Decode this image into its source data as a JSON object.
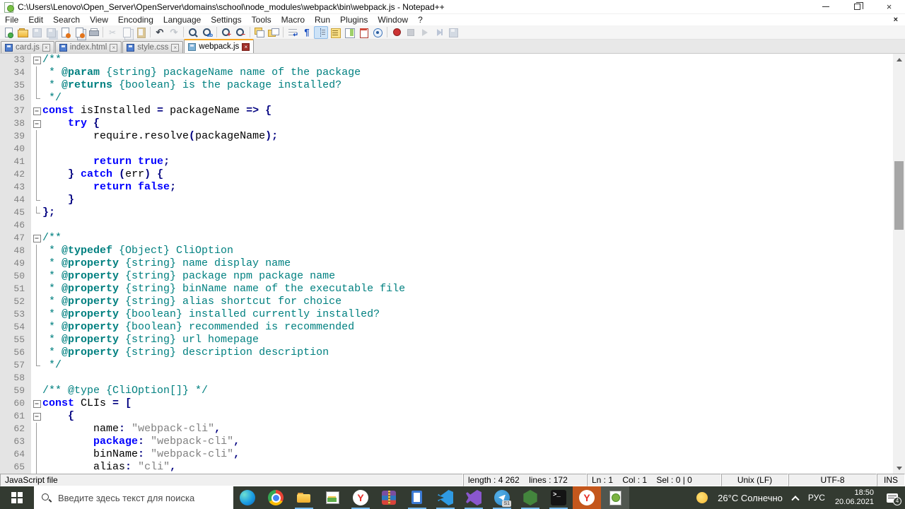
{
  "colors": {
    "comment": "#008080",
    "keyword": "#0000ff",
    "operator": "#000080",
    "string": "#808080",
    "line_number": "#808080",
    "margin_bg": "#e4e4e4",
    "tab_accent": "#f5a623",
    "taskbar_bg": "#333a31",
    "taskbar_active_bg": "#c4571c",
    "taskbar_running_underline": "#76b9ed"
  },
  "window": {
    "title": "C:\\Users\\Lenovo\\Open_Server\\OpenServer\\domains\\school\\node_modules\\webpack\\bin\\webpack.js - Notepad++"
  },
  "menu": {
    "items": [
      "File",
      "Edit",
      "Search",
      "View",
      "Encoding",
      "Language",
      "Settings",
      "Tools",
      "Macro",
      "Run",
      "Plugins",
      "Window",
      "?"
    ],
    "close_label": "×"
  },
  "toolbar": {
    "items": [
      {
        "name": "new-file"
      },
      {
        "name": "open-file"
      },
      {
        "name": "save-file",
        "disabled": true
      },
      {
        "name": "save-all",
        "disabled": true
      },
      {
        "name": "close-file"
      },
      {
        "name": "close-all"
      },
      {
        "name": "print"
      },
      {
        "sep": true
      },
      {
        "name": "cut",
        "disabled": true
      },
      {
        "name": "copy",
        "disabled": true
      },
      {
        "name": "paste",
        "disabled": true
      },
      {
        "sep": true
      },
      {
        "name": "undo"
      },
      {
        "name": "redo",
        "disabled": true
      },
      {
        "sep": true
      },
      {
        "name": "find"
      },
      {
        "name": "replace"
      },
      {
        "sep": true
      },
      {
        "name": "zoom-in"
      },
      {
        "name": "zoom-out"
      },
      {
        "sep": true
      },
      {
        "name": "sync-vertical"
      },
      {
        "name": "sync-horizontal"
      },
      {
        "sep": true
      },
      {
        "name": "word-wrap"
      },
      {
        "name": "show-all-characters"
      },
      {
        "name": "indent-guides",
        "selected": true
      },
      {
        "name": "function-list"
      },
      {
        "name": "document-map"
      },
      {
        "name": "document-list"
      },
      {
        "name": "monitoring"
      },
      {
        "sep": true
      },
      {
        "name": "record-macro"
      },
      {
        "name": "stop-macro",
        "disabled": true
      },
      {
        "name": "play-macro",
        "disabled": true
      },
      {
        "name": "run-macro-multiple",
        "disabled": true
      },
      {
        "name": "save-macro",
        "disabled": true
      }
    ]
  },
  "tabs": [
    {
      "label": "card.js"
    },
    {
      "label": "index.html"
    },
    {
      "label": "style.css"
    },
    {
      "label": "webpack.js",
      "active": true
    }
  ],
  "editor": {
    "lines": [
      {
        "n": 33,
        "f": "box",
        "segs": [
          [
            "c",
            "/**"
          ]
        ]
      },
      {
        "n": 34,
        "f": "v",
        "segs": [
          [
            "c",
            " * "
          ],
          [
            "cb",
            "@param"
          ],
          [
            "c",
            " {string} packageName name of the package"
          ]
        ]
      },
      {
        "n": 35,
        "f": "v",
        "segs": [
          [
            "c",
            " * "
          ],
          [
            "cb",
            "@returns"
          ],
          [
            "c",
            " {boolean} is the package installed?"
          ]
        ]
      },
      {
        "n": 36,
        "f": "end",
        "segs": [
          [
            "c",
            " */"
          ]
        ]
      },
      {
        "n": 37,
        "f": "box",
        "segs": [
          [
            "k",
            "const"
          ],
          [
            "d",
            " isInstalled "
          ],
          [
            "o",
            "="
          ],
          [
            "d",
            " packageName "
          ],
          [
            "o",
            "=>"
          ],
          [
            "d",
            " "
          ],
          [
            "o",
            "{"
          ]
        ]
      },
      {
        "n": 38,
        "f": "box",
        "segs": [
          [
            "d",
            "    "
          ],
          [
            "k",
            "try"
          ],
          [
            "d",
            " "
          ],
          [
            "o",
            "{"
          ]
        ]
      },
      {
        "n": 39,
        "f": "v",
        "segs": [
          [
            "d",
            "        require.resolve"
          ],
          [
            "o",
            "("
          ],
          [
            "d",
            "packageName"
          ],
          [
            "o",
            ");"
          ]
        ]
      },
      {
        "n": 40,
        "f": "v",
        "segs": []
      },
      {
        "n": 41,
        "f": "v",
        "segs": [
          [
            "d",
            "        "
          ],
          [
            "k",
            "return"
          ],
          [
            "d",
            " "
          ],
          [
            "k",
            "true"
          ],
          [
            "o",
            ";"
          ]
        ]
      },
      {
        "n": 42,
        "f": "v",
        "segs": [
          [
            "d",
            "    "
          ],
          [
            "o",
            "}"
          ],
          [
            "d",
            " "
          ],
          [
            "k",
            "catch"
          ],
          [
            "d",
            " "
          ],
          [
            "o",
            "("
          ],
          [
            "d",
            "err"
          ],
          [
            "o",
            ")"
          ],
          [
            "d",
            " "
          ],
          [
            "o",
            "{"
          ]
        ]
      },
      {
        "n": 43,
        "f": "v",
        "segs": [
          [
            "d",
            "        "
          ],
          [
            "k",
            "return"
          ],
          [
            "d",
            " "
          ],
          [
            "k",
            "false"
          ],
          [
            "o",
            ";"
          ]
        ]
      },
      {
        "n": 44,
        "f": "end",
        "segs": [
          [
            "d",
            "    "
          ],
          [
            "o",
            "}"
          ]
        ]
      },
      {
        "n": 45,
        "f": "end",
        "segs": [
          [
            "o",
            "};"
          ]
        ]
      },
      {
        "n": 46,
        "f": "",
        "segs": []
      },
      {
        "n": 47,
        "f": "box",
        "segs": [
          [
            "c",
            "/**"
          ]
        ]
      },
      {
        "n": 48,
        "f": "v",
        "segs": [
          [
            "c",
            " * "
          ],
          [
            "cb",
            "@typedef"
          ],
          [
            "c",
            " {Object} CliOption"
          ]
        ]
      },
      {
        "n": 49,
        "f": "v",
        "segs": [
          [
            "c",
            " * "
          ],
          [
            "cb",
            "@property"
          ],
          [
            "c",
            " {string} name display name"
          ]
        ]
      },
      {
        "n": 50,
        "f": "v",
        "segs": [
          [
            "c",
            " * "
          ],
          [
            "cb",
            "@property"
          ],
          [
            "c",
            " {string} package npm package name"
          ]
        ]
      },
      {
        "n": 51,
        "f": "v",
        "segs": [
          [
            "c",
            " * "
          ],
          [
            "cb",
            "@property"
          ],
          [
            "c",
            " {string} binName name of the executable file"
          ]
        ]
      },
      {
        "n": 52,
        "f": "v",
        "segs": [
          [
            "c",
            " * "
          ],
          [
            "cb",
            "@property"
          ],
          [
            "c",
            " {string} alias shortcut for choice"
          ]
        ]
      },
      {
        "n": 53,
        "f": "v",
        "segs": [
          [
            "c",
            " * "
          ],
          [
            "cb",
            "@property"
          ],
          [
            "c",
            " {boolean} installed currently installed?"
          ]
        ]
      },
      {
        "n": 54,
        "f": "v",
        "segs": [
          [
            "c",
            " * "
          ],
          [
            "cb",
            "@property"
          ],
          [
            "c",
            " {boolean} recommended is recommended"
          ]
        ]
      },
      {
        "n": 55,
        "f": "v",
        "segs": [
          [
            "c",
            " * "
          ],
          [
            "cb",
            "@property"
          ],
          [
            "c",
            " {string} url homepage"
          ]
        ]
      },
      {
        "n": 56,
        "f": "v",
        "segs": [
          [
            "c",
            " * "
          ],
          [
            "cb",
            "@property"
          ],
          [
            "c",
            " {string} description description"
          ]
        ]
      },
      {
        "n": 57,
        "f": "end",
        "segs": [
          [
            "c",
            " */"
          ]
        ]
      },
      {
        "n": 58,
        "f": "",
        "segs": []
      },
      {
        "n": 59,
        "f": "",
        "segs": [
          [
            "c",
            "/** @type {CliOption[]} */"
          ]
        ]
      },
      {
        "n": 60,
        "f": "box",
        "segs": [
          [
            "k",
            "const"
          ],
          [
            "d",
            " CLIs "
          ],
          [
            "o",
            "="
          ],
          [
            "d",
            " "
          ],
          [
            "o",
            "["
          ]
        ]
      },
      {
        "n": 61,
        "f": "box",
        "segs": [
          [
            "d",
            "    "
          ],
          [
            "o",
            "{"
          ]
        ]
      },
      {
        "n": 62,
        "f": "v",
        "segs": [
          [
            "d",
            "        name"
          ],
          [
            "o",
            ":"
          ],
          [
            "d",
            " "
          ],
          [
            "s",
            "\"webpack-cli\""
          ],
          [
            "o",
            ","
          ]
        ]
      },
      {
        "n": 63,
        "f": "v",
        "segs": [
          [
            "d",
            "        "
          ],
          [
            "k",
            "package"
          ],
          [
            "o",
            ":"
          ],
          [
            "d",
            " "
          ],
          [
            "s",
            "\"webpack-cli\""
          ],
          [
            "o",
            ","
          ]
        ]
      },
      {
        "n": 64,
        "f": "v",
        "segs": [
          [
            "d",
            "        binName"
          ],
          [
            "o",
            ":"
          ],
          [
            "d",
            " "
          ],
          [
            "s",
            "\"webpack-cli\""
          ],
          [
            "o",
            ","
          ]
        ]
      },
      {
        "n": 65,
        "f": "v",
        "segs": [
          [
            "d",
            "        alias"
          ],
          [
            "o",
            ":"
          ],
          [
            "d",
            " "
          ],
          [
            "s",
            "\"cli\""
          ],
          [
            "o",
            ","
          ]
        ]
      }
    ]
  },
  "statusbar": {
    "doc_type": "JavaScript file",
    "length_lines": "length : 4 262    lines : 172",
    "position": "Ln : 1    Col : 1    Sel : 0 | 0",
    "eol": "Unix (LF)",
    "encoding": "UTF-8",
    "mode": "INS"
  },
  "taskbar": {
    "search_placeholder": "Введите здесь текст для поиска",
    "apps": [
      {
        "name": "edge"
      },
      {
        "name": "chrome"
      },
      {
        "name": "file-explorer",
        "running": true
      },
      {
        "name": "image-editor"
      },
      {
        "name": "yandex-browser",
        "icon": "yandex",
        "running": true
      },
      {
        "name": "winrar"
      },
      {
        "name": "notepad",
        "running": true
      },
      {
        "name": "vscode",
        "running": true
      },
      {
        "name": "visual-studio",
        "running": true
      },
      {
        "name": "telegram",
        "running": true,
        "badge": "S1"
      },
      {
        "name": "nodejs",
        "running": true
      },
      {
        "name": "terminal",
        "running": true
      },
      {
        "name": "yandex-browser-window",
        "icon": "yandex",
        "active": "orange"
      },
      {
        "name": "notepad-plus-plus",
        "active": "gray"
      }
    ],
    "tray": {
      "weather": "26°C Солнечно",
      "lang": "РУС",
      "time": "18:50",
      "date": "20.06.2021",
      "notification_count": "4"
    }
  }
}
